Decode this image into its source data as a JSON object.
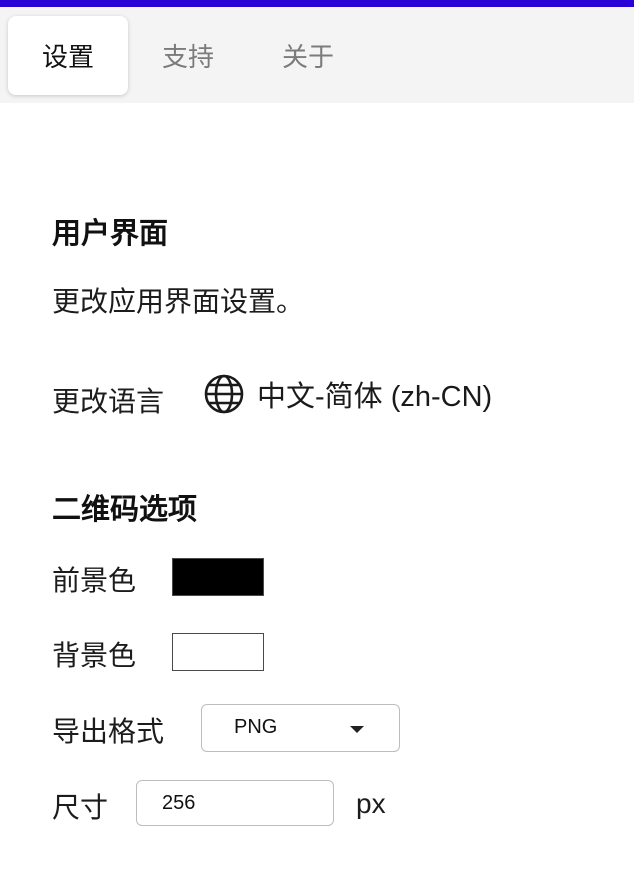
{
  "tabs": [
    {
      "label": "设置",
      "active": true
    },
    {
      "label": "支持",
      "active": false
    },
    {
      "label": "关于",
      "active": false
    }
  ],
  "ui_section": {
    "title": "用户界面",
    "description": "更改应用界面设置。",
    "language_label": "更改语言",
    "language_icon": "globe-icon",
    "language_value": "中文-简体 (zh-CN)"
  },
  "qr_section": {
    "title": "二维码选项",
    "foreground_label": "前景色",
    "foreground_color": "#000000",
    "background_label": "背景色",
    "background_color": "#ffffff",
    "format_label": "导出格式",
    "format_value": "PNG",
    "size_label": "尺寸",
    "size_value": "256",
    "size_unit": "px"
  },
  "colors": {
    "accent_bar": "#2b00d6"
  }
}
